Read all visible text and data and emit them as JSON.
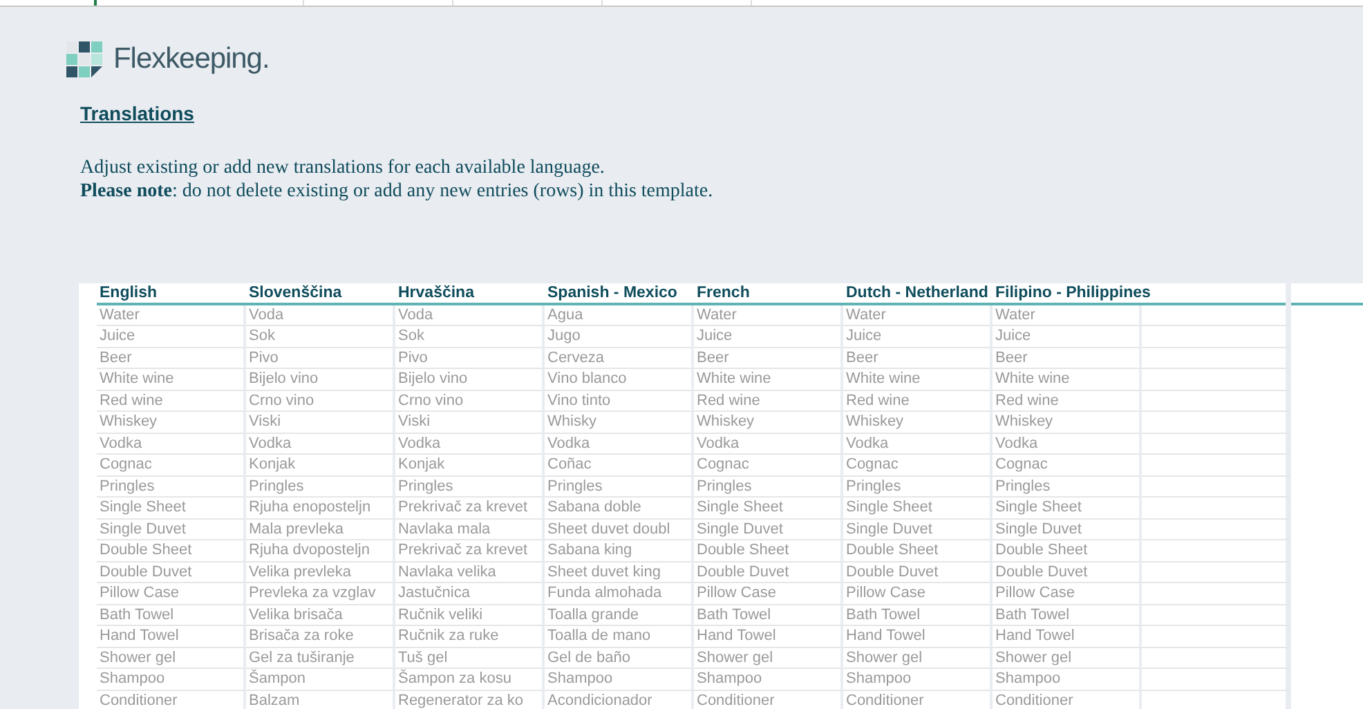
{
  "brand": {
    "name": "Flexkeeping."
  },
  "heading": "Translations",
  "intro": "Adjust existing or add new translations for each available language.",
  "note": "**Please note**: do not delete existing or add any new entries (rows) in this template.",
  "table": {
    "columns": [
      "English",
      "Slovenščina",
      "Hrvaščina",
      "Spanish - Mexico",
      "French",
      "Dutch - Netherland",
      "Filipino - Philippines"
    ],
    "rows": [
      [
        "Water",
        "Voda",
        "Voda",
        "Agua",
        "Water",
        "Water",
        "Water"
      ],
      [
        "Juice",
        "Sok",
        "Sok",
        "Jugo",
        "Juice",
        "Juice",
        "Juice"
      ],
      [
        "Beer",
        "Pivo",
        "Pivo",
        "Cerveza",
        "Beer",
        "Beer",
        "Beer"
      ],
      [
        "White wine",
        "Bijelo vino",
        "Bijelo vino",
        "Vino blanco",
        "White wine",
        "White wine",
        "White wine"
      ],
      [
        "Red wine",
        "Crno vino",
        "Crno vino",
        "Vino tinto",
        "Red wine",
        "Red wine",
        "Red wine"
      ],
      [
        "Whiskey",
        "Viski",
        "Viski",
        "Whisky",
        "Whiskey",
        "Whiskey",
        "Whiskey"
      ],
      [
        "Vodka",
        "Vodka",
        "Vodka",
        "Vodka",
        "Vodka",
        "Vodka",
        "Vodka"
      ],
      [
        "Cognac",
        "Konjak",
        "Konjak",
        "Coñac",
        "Cognac",
        "Cognac",
        "Cognac"
      ],
      [
        "Pringles",
        "Pringles",
        "Pringles",
        "Pringles",
        "Pringles",
        "Pringles",
        "Pringles"
      ],
      [
        "Single Sheet",
        "Rjuha enoposteljn",
        "Prekrivač za krevet",
        "Sabana doble",
        "Single Sheet",
        "Single Sheet",
        "Single Sheet"
      ],
      [
        "Single Duvet",
        "Mala prevleka",
        "Navlaka mala",
        "Sheet duvet doubl",
        "Single Duvet",
        "Single Duvet",
        "Single Duvet"
      ],
      [
        "Double Sheet",
        "Rjuha dvoposteljn",
        "Prekrivač za krevet",
        "Sabana king",
        "Double Sheet",
        "Double Sheet",
        "Double Sheet"
      ],
      [
        "Double Duvet",
        "Velika prevleka",
        "Navlaka velika",
        "Sheet duvet king",
        "Double Duvet",
        "Double Duvet",
        "Double Duvet"
      ],
      [
        "Pillow Case",
        "Prevleka za vzglav",
        "Jastučnica",
        "Funda almohada",
        "Pillow Case",
        "Pillow Case",
        "Pillow Case"
      ],
      [
        "Bath Towel",
        "Velika brisača",
        "Ručnik veliki",
        "Toalla grande",
        "Bath Towel",
        "Bath Towel",
        "Bath Towel"
      ],
      [
        "Hand Towel",
        "Brisača za roke",
        "Ručnik za ruke",
        "Toalla de mano",
        "Hand Towel",
        "Hand Towel",
        "Hand Towel"
      ],
      [
        "Shower gel",
        "Gel za tuširanje",
        "Tuš gel",
        "Gel de baño",
        "Shower gel",
        "Shower gel",
        "Shower gel"
      ],
      [
        "Shampoo",
        "Šampon",
        "Šampon za kosu",
        "Shampoo",
        "Shampoo",
        "Shampoo",
        "Shampoo"
      ],
      [
        "Conditioner",
        "Balzam",
        "Regenerator za ko",
        "Acondicionador",
        "Conditioner",
        "Conditioner",
        "Conditioner"
      ]
    ]
  }
}
